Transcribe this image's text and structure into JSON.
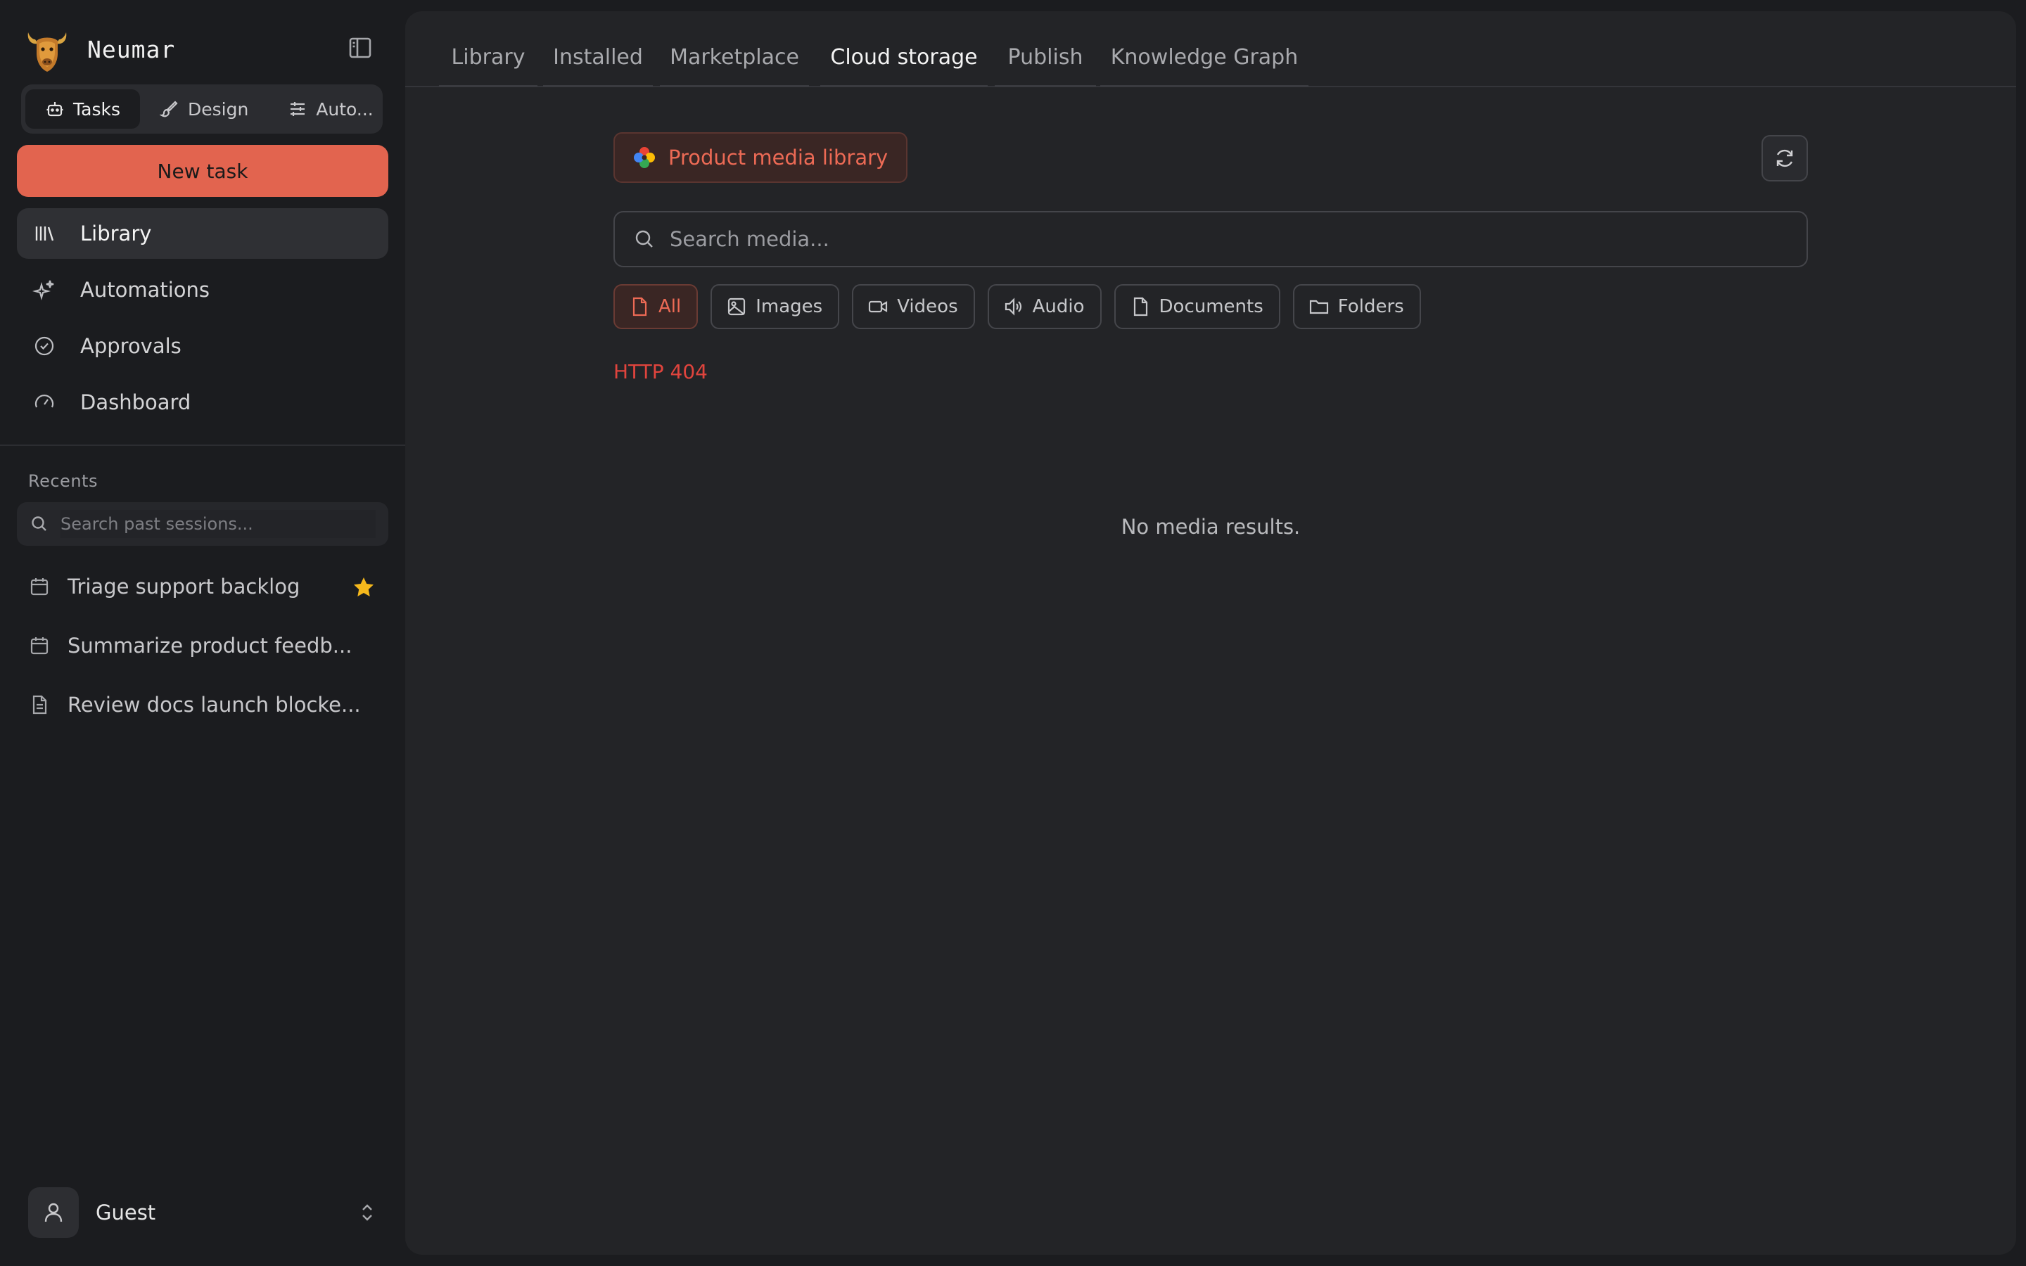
{
  "app": {
    "name": "Neumar"
  },
  "sidebar": {
    "mode_tabs": [
      {
        "label": "Tasks",
        "icon": "robot-icon",
        "active": true
      },
      {
        "label": "Design",
        "icon": "brush-icon",
        "active": false
      },
      {
        "label": "Auto...",
        "icon": "sliders-icon",
        "active": false
      }
    ],
    "new_task_label": "New task",
    "nav": [
      {
        "label": "Library",
        "icon": "library-icon",
        "active": true
      },
      {
        "label": "Automations",
        "icon": "sparkles-icon",
        "active": false
      },
      {
        "label": "Approvals",
        "icon": "check-circle-icon",
        "active": false
      },
      {
        "label": "Dashboard",
        "icon": "gauge-icon",
        "active": false
      }
    ],
    "recents_title": "Recents",
    "session_search_placeholder": "Search past sessions...",
    "recents": [
      {
        "label": "Triage support backlog",
        "icon": "calendar-icon",
        "starred": true
      },
      {
        "label": "Summarize product feedb...",
        "icon": "calendar-icon",
        "starred": false
      },
      {
        "label": "Review docs launch blocke...",
        "icon": "document-icon",
        "starred": false
      }
    ],
    "user": {
      "name": "Guest"
    }
  },
  "main": {
    "tabs": [
      {
        "label": "Library",
        "active": false
      },
      {
        "label": "Installed",
        "active": false
      },
      {
        "label": "Marketplace",
        "active": false
      },
      {
        "label": "Cloud storage",
        "active": true
      },
      {
        "label": "Publish",
        "active": false
      },
      {
        "label": "Knowledge Graph",
        "active": false
      }
    ],
    "source_label": "Product media library",
    "search_placeholder": "Search media...",
    "filters": [
      {
        "label": "All",
        "icon": "file-icon",
        "active": true
      },
      {
        "label": "Images",
        "icon": "image-icon",
        "active": false
      },
      {
        "label": "Videos",
        "icon": "video-icon",
        "active": false
      },
      {
        "label": "Audio",
        "icon": "speaker-icon",
        "active": false
      },
      {
        "label": "Documents",
        "icon": "document-icon",
        "active": false
      },
      {
        "label": "Folders",
        "icon": "folder-icon",
        "active": false
      }
    ],
    "error": "HTTP 404",
    "empty_message": "No media results."
  },
  "colors": {
    "accent": "#e2644f",
    "accent_text": "#ec6a55",
    "error": "#e0443d",
    "star": "#f5b81c",
    "sidebar_bg": "#1b1c1f",
    "panel_bg": "#232427"
  }
}
